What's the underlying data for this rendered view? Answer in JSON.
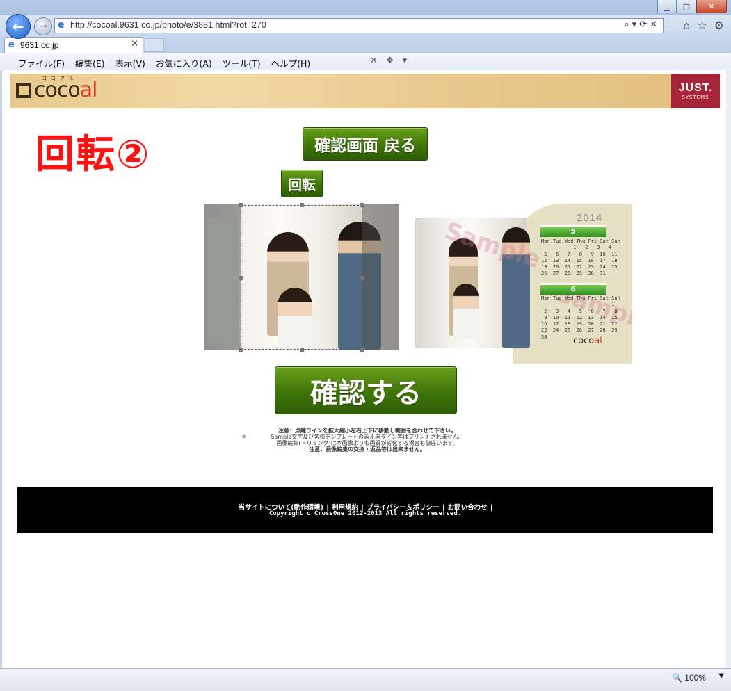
{
  "browser": {
    "url": "http://cocoal.9631.co.jp/photo/e/3881.html?rot=270",
    "tab_label": "9631.co.jp",
    "menu": [
      "ファイル(F)",
      "編集(E)",
      "表示(V)",
      "お気に入り(A)",
      "ツール(T)",
      "ヘルプ(H)"
    ],
    "zoom": "100%"
  },
  "header": {
    "logo_text": "coco",
    "logo_accent": "al",
    "logo_ruby": "ココアル",
    "badge_line1": "JUST.",
    "badge_line2": "SYSTEMS"
  },
  "annotation": "回転②",
  "buttons": {
    "back": "確認画面 戻る",
    "rotate": "回転",
    "confirm": "確認する"
  },
  "calendar": {
    "year": "2014",
    "month1": "5",
    "month2": "6",
    "month1_rows": "Mon Tue Wed Thu Fri Sat Sun\n           1   2   3   4\n 5   6   7   8   9  10  11\n12  13  14  15  16  17  18\n19  20  21  22  23  24  25\n26  27  28  29  30  31",
    "month2_rows": "Mon Tue Wed Thu Fri Sat Sun\n                        1\n 2   3   4   5   6   7   8\n 9  10  11  12  13  14  15\n16  17  18  19  20  21  22\n23  24  25  26  27  28  29\n30",
    "logo_text": "coco",
    "logo_accent": "al",
    "watermark": "Sample"
  },
  "notes": {
    "line1": "注意：点線ラインを拡大縮小左右上下に移動し範囲を合わせて下さい。",
    "line2": "Sample文字及び各種テンプレートの青＆黒ライン等はプリントされません。",
    "line3": "画像編集(トリミング)は本画像よりも画質が劣化する場合も御座います。",
    "line4": "注意：画像編集の交換・返品等は出来ません。",
    "star": "＊"
  },
  "footer": {
    "links": [
      "当サイトについて(動作環境)",
      "利用規約",
      "プライバシー＆ポリシー",
      "お問い合わせ"
    ],
    "copyright": "Copyright c CrossOne 2012-2013 All rights reserved."
  },
  "colors": {
    "button_green": "#3d7509",
    "annotation_red": "#ff1111",
    "footer_bg": "#000000",
    "calendar_green": "#2f8f1e"
  }
}
